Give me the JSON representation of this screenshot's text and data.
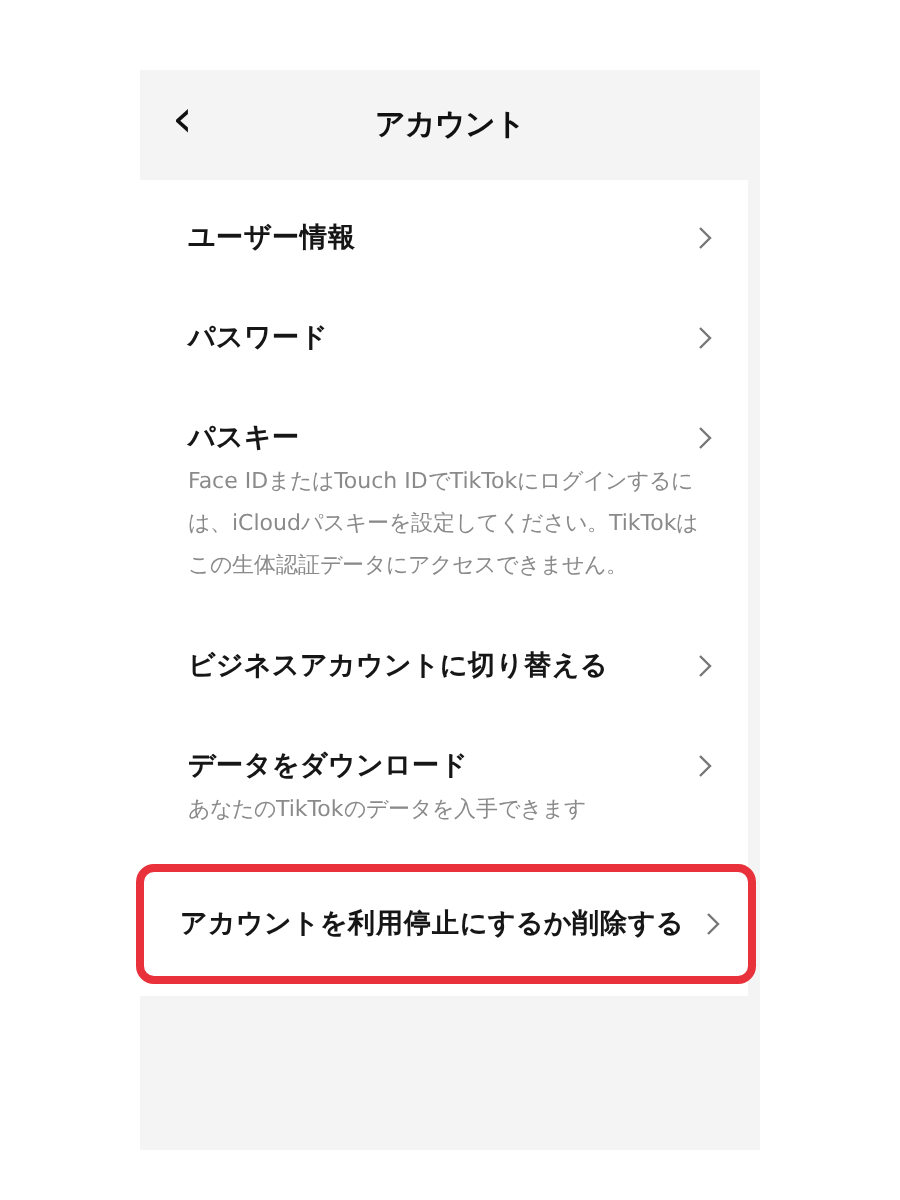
{
  "header": {
    "back": "‹",
    "title": "アカウント"
  },
  "items": [
    {
      "label": "ユーザー情報",
      "highlighted": false
    },
    {
      "label": "パスワード",
      "highlighted": false
    },
    {
      "label": "パスキー",
      "description": "Face IDまたはTouch IDでTikTokにログインするには、iCloudパスキーを設定してください。TikTokはこの生体認証データにアクセスできません。",
      "highlighted": false
    },
    {
      "label": "ビジネスアカウントに切り替える",
      "highlighted": false
    },
    {
      "label": "データをダウンロード",
      "description": "あなたのTikTokのデータを入手できます",
      "highlighted": false
    },
    {
      "label": "アカウントを利用停止にするか削除する",
      "highlighted": true
    }
  ]
}
